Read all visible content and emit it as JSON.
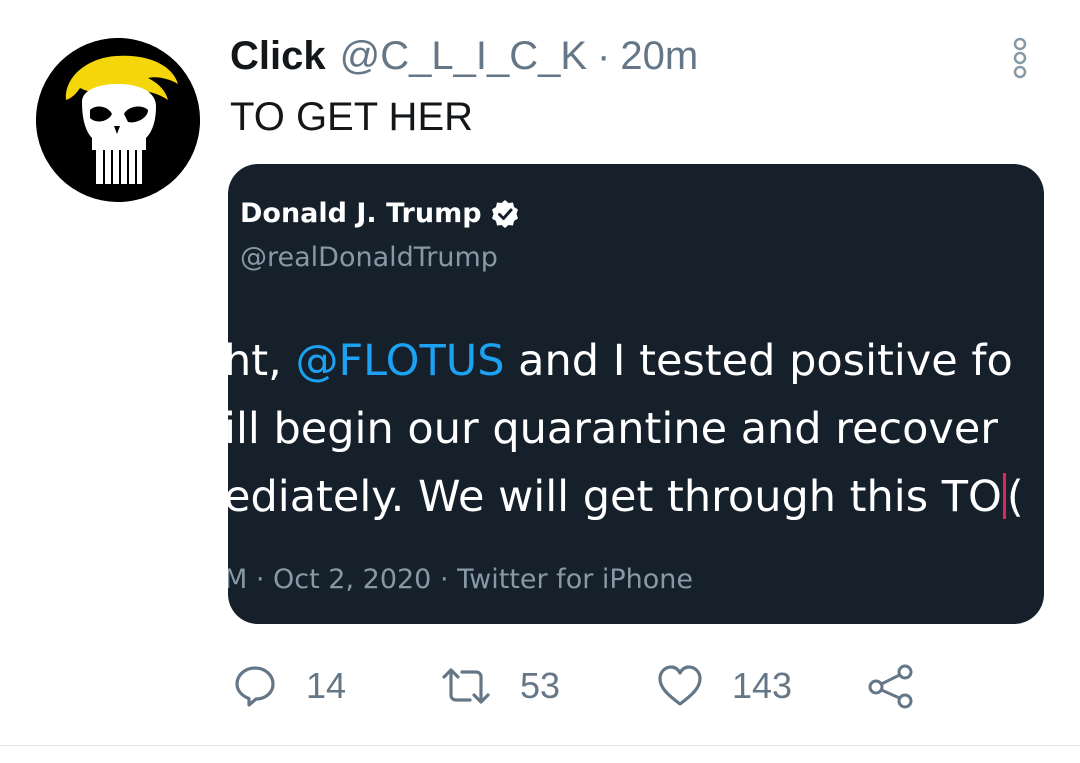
{
  "tweet": {
    "author_name": "Click",
    "author_handle": "@C_L_I_C_K",
    "separator": "·",
    "time": "20m",
    "text": "TO GET HER",
    "avatar_icon": "punisher-skull-with-blonde-hair-icon"
  },
  "quoted_image": {
    "name": "Donald J. Trump",
    "handle": "@realDonaldTrump",
    "line1_pre": "ht, ",
    "line1_mention": "@FLOTUS",
    "line1_post": " and I tested positive fo",
    "line2": "ill begin our quarantine and recover",
    "line3_pre": "ediately. We will get through this TO",
    "line3_post": "(",
    "meta": "M · Oct 2, 2020 · Twitter for iPhone"
  },
  "actions": {
    "reply_count": "14",
    "retweet_count": "53",
    "like_count": "143"
  },
  "colors": {
    "text": "#14171a",
    "secondary": "#657786",
    "card_bg": "#15202b",
    "mention": "#1da1f2",
    "cursor": "#e0245e"
  }
}
